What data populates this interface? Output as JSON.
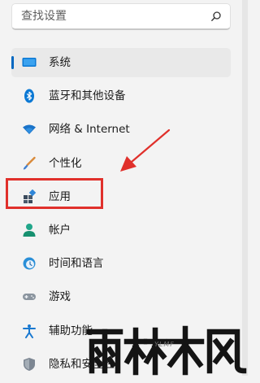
{
  "search": {
    "placeholder": "查找设置"
  },
  "nav": {
    "items": [
      {
        "label": "系统",
        "icon": "display-icon",
        "selected": true
      },
      {
        "label": "蓝牙和其他设备",
        "icon": "bluetooth-icon"
      },
      {
        "label": "网络 & Internet",
        "icon": "wifi-icon"
      },
      {
        "label": "个性化",
        "icon": "paint-brush-icon"
      },
      {
        "label": "应用",
        "icon": "apps-icon"
      },
      {
        "label": "帐户",
        "icon": "account-icon"
      },
      {
        "label": "时间和语言",
        "icon": "clock-globe-icon"
      },
      {
        "label": "游戏",
        "icon": "gamepad-icon"
      },
      {
        "label": "辅助功能",
        "icon": "accessibility-icon"
      },
      {
        "label": "隐私和安全性",
        "icon": "shield-icon"
      }
    ]
  },
  "annotation": {
    "color": "#e0302b",
    "target": "应用"
  },
  "watermark": {
    "logo_text": "雨林木风",
    "text": "YLMF"
  },
  "colors": {
    "accent": "#0067c0",
    "background": "#f3f3f3",
    "selected_background": "#e9e9e9"
  }
}
